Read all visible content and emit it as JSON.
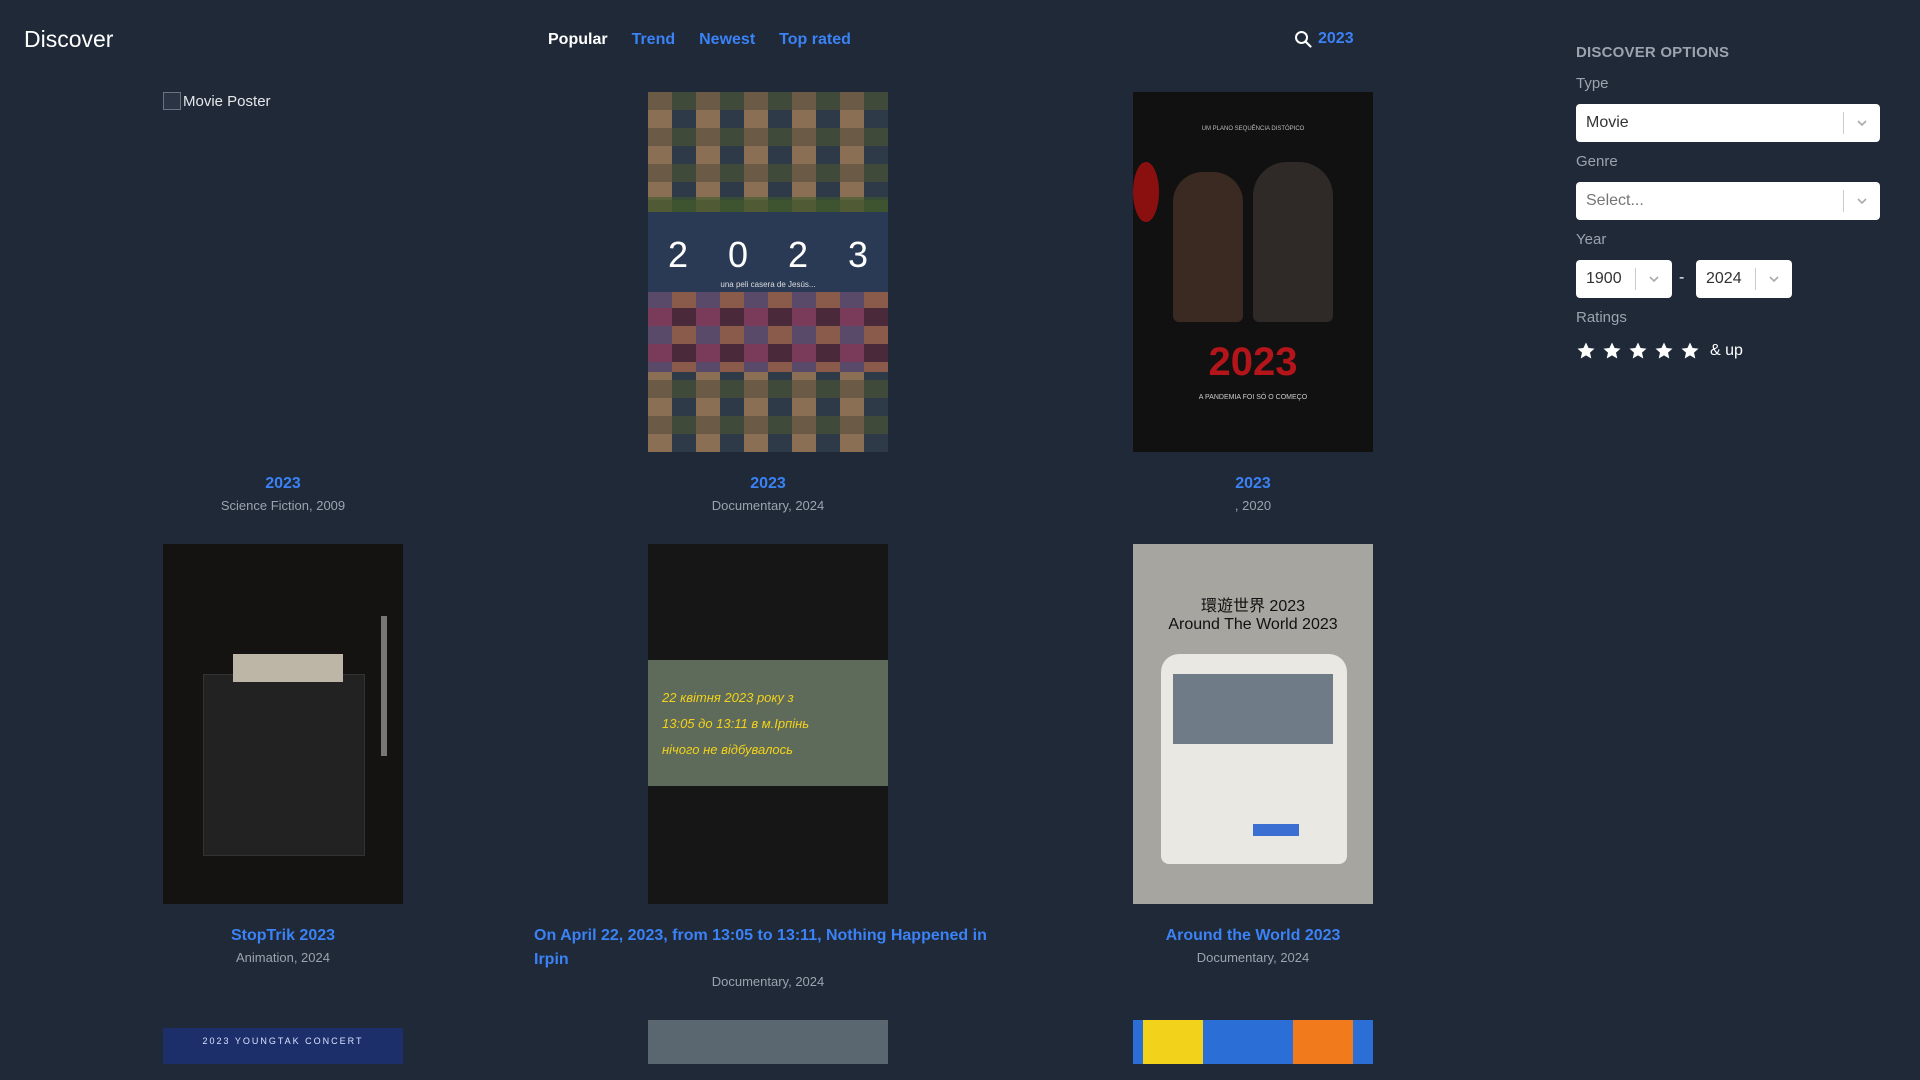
{
  "header": {
    "brand": "Discover",
    "tabs": [
      {
        "label": "Popular",
        "active": true
      },
      {
        "label": "Trend",
        "active": false
      },
      {
        "label": "Newest",
        "active": false
      },
      {
        "label": "Top rated",
        "active": false
      }
    ],
    "search_query": "2023",
    "search_icon": "search-icon"
  },
  "movies": [
    {
      "title": "2023",
      "meta": "Science Fiction, 2009",
      "poster_alt": "Movie Poster"
    },
    {
      "title": "2023",
      "meta": "Documentary, 2024"
    },
    {
      "title": "2023",
      "meta": ", 2020"
    },
    {
      "title": "StopTrik 2023",
      "meta": "Animation, 2024"
    },
    {
      "title": "On April 22, 2023, from 13:05 to 13:11, Nothing Happened in Irpin",
      "meta": "Documentary, 2024"
    },
    {
      "title": "Around the World 2023",
      "meta": "Documentary, 2024"
    }
  ],
  "poster_text": {
    "p2_digits": [
      "2",
      "0",
      "2",
      "3"
    ],
    "p2_caption": "una peli casera de Jesús...",
    "p3_top": "UM PLANO SEQUÊNCIA DISTÓPICO",
    "p3_year": "2023",
    "p3_tag": "A PANDEMIA FOI SÓ O COMEÇO",
    "p5_lines": [
      "22 квітня 2023 року з",
      "13:05 до 13:11 в м.Ірпінь",
      "нічого не відбувалось"
    ],
    "p6_lines": [
      "環遊世界 2023",
      "Around The World 2023"
    ],
    "p7_text": "2023 YOUNGTAK CONCERT"
  },
  "sidebar": {
    "title": "DISCOVER OPTIONS",
    "type_label": "Type",
    "type_value": "Movie",
    "genre_label": "Genre",
    "genre_placeholder": "Select...",
    "year_label": "Year",
    "year_from": "1900",
    "year_to": "2024",
    "year_separator": "-",
    "ratings_label": "Ratings",
    "ratings_suffix": "& up",
    "star_icon": "star-icon",
    "chevron_icon": "chevron-down-icon"
  },
  "colors": {
    "background": "#1f2937",
    "accent": "#3b82f6",
    "muted": "#9ca3af"
  }
}
